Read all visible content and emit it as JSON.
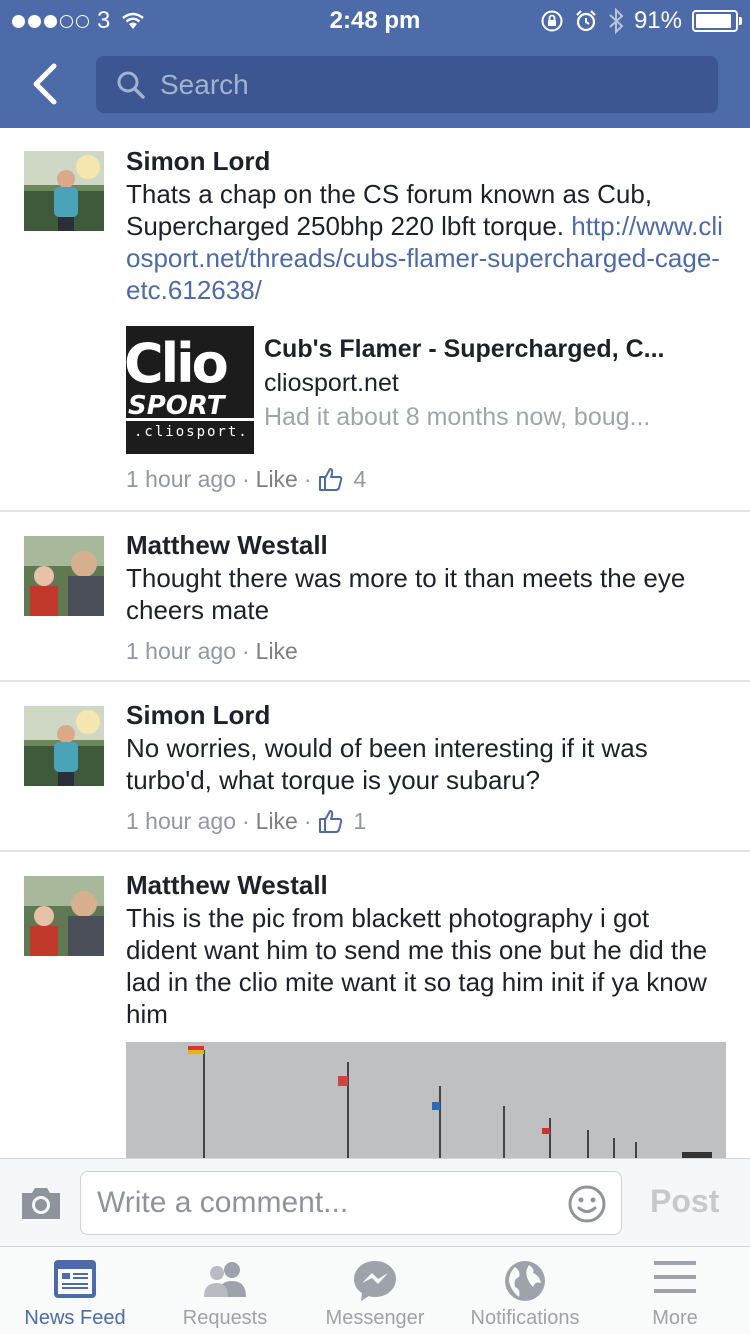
{
  "status_bar": {
    "carrier": "3",
    "time": "2:48 pm",
    "battery": "91%",
    "battery_level": 0.91
  },
  "search": {
    "placeholder": "Search"
  },
  "comments": [
    {
      "author": "Simon Lord",
      "text": "Thats a chap on the CS forum known as Cub, Supercharged 250bhp 220 lbft torque. ",
      "link": "http://www.cliosport.net/threads/cubs-flamer-supercharged-cage-etc.612638/",
      "preview": {
        "logo_main": "Clio",
        "logo_sub": "SPORT",
        "logo_domain": ".cliosport.",
        "title": "Cub's Flamer - Supercharged, C...",
        "domain": "cliosport.net",
        "description": "Had it about 8 months now, boug..."
      },
      "time": "1 hour ago",
      "like_label": "Like",
      "likes": "4"
    },
    {
      "author": "Matthew Westall",
      "text": "Thought there was more to it than meets the eye cheers mate",
      "time": "1 hour ago",
      "like_label": "Like"
    },
    {
      "author": "Simon Lord",
      "text": "No worries, would of been interesting if it was turbo'd, what torque is your subaru?",
      "time": "1 hour ago",
      "like_label": "Like",
      "likes": "1"
    },
    {
      "author": "Matthew Westall",
      "text": "This is the pic from blackett photography i got dident want him to send me this one but he did the lad in the clio mite want it so tag him init if ya know him",
      "time": "",
      "like_label": ""
    }
  ],
  "composer": {
    "placeholder": "Write a comment...",
    "post_label": "Post"
  },
  "tabs": [
    {
      "label": "News Feed",
      "icon": "news-feed-icon",
      "active": true
    },
    {
      "label": "Requests",
      "icon": "friend-requests-icon",
      "active": false
    },
    {
      "label": "Messenger",
      "icon": "messenger-icon",
      "active": false
    },
    {
      "label": "Notifications",
      "icon": "globe-icon",
      "active": false
    },
    {
      "label": "More",
      "icon": "menu-icon",
      "active": false
    }
  ],
  "colors": {
    "brand_blue": "#4c6ba8",
    "search_bg": "#3b5690",
    "muted_text": "#9197a3",
    "link": "#4c6ba8"
  }
}
